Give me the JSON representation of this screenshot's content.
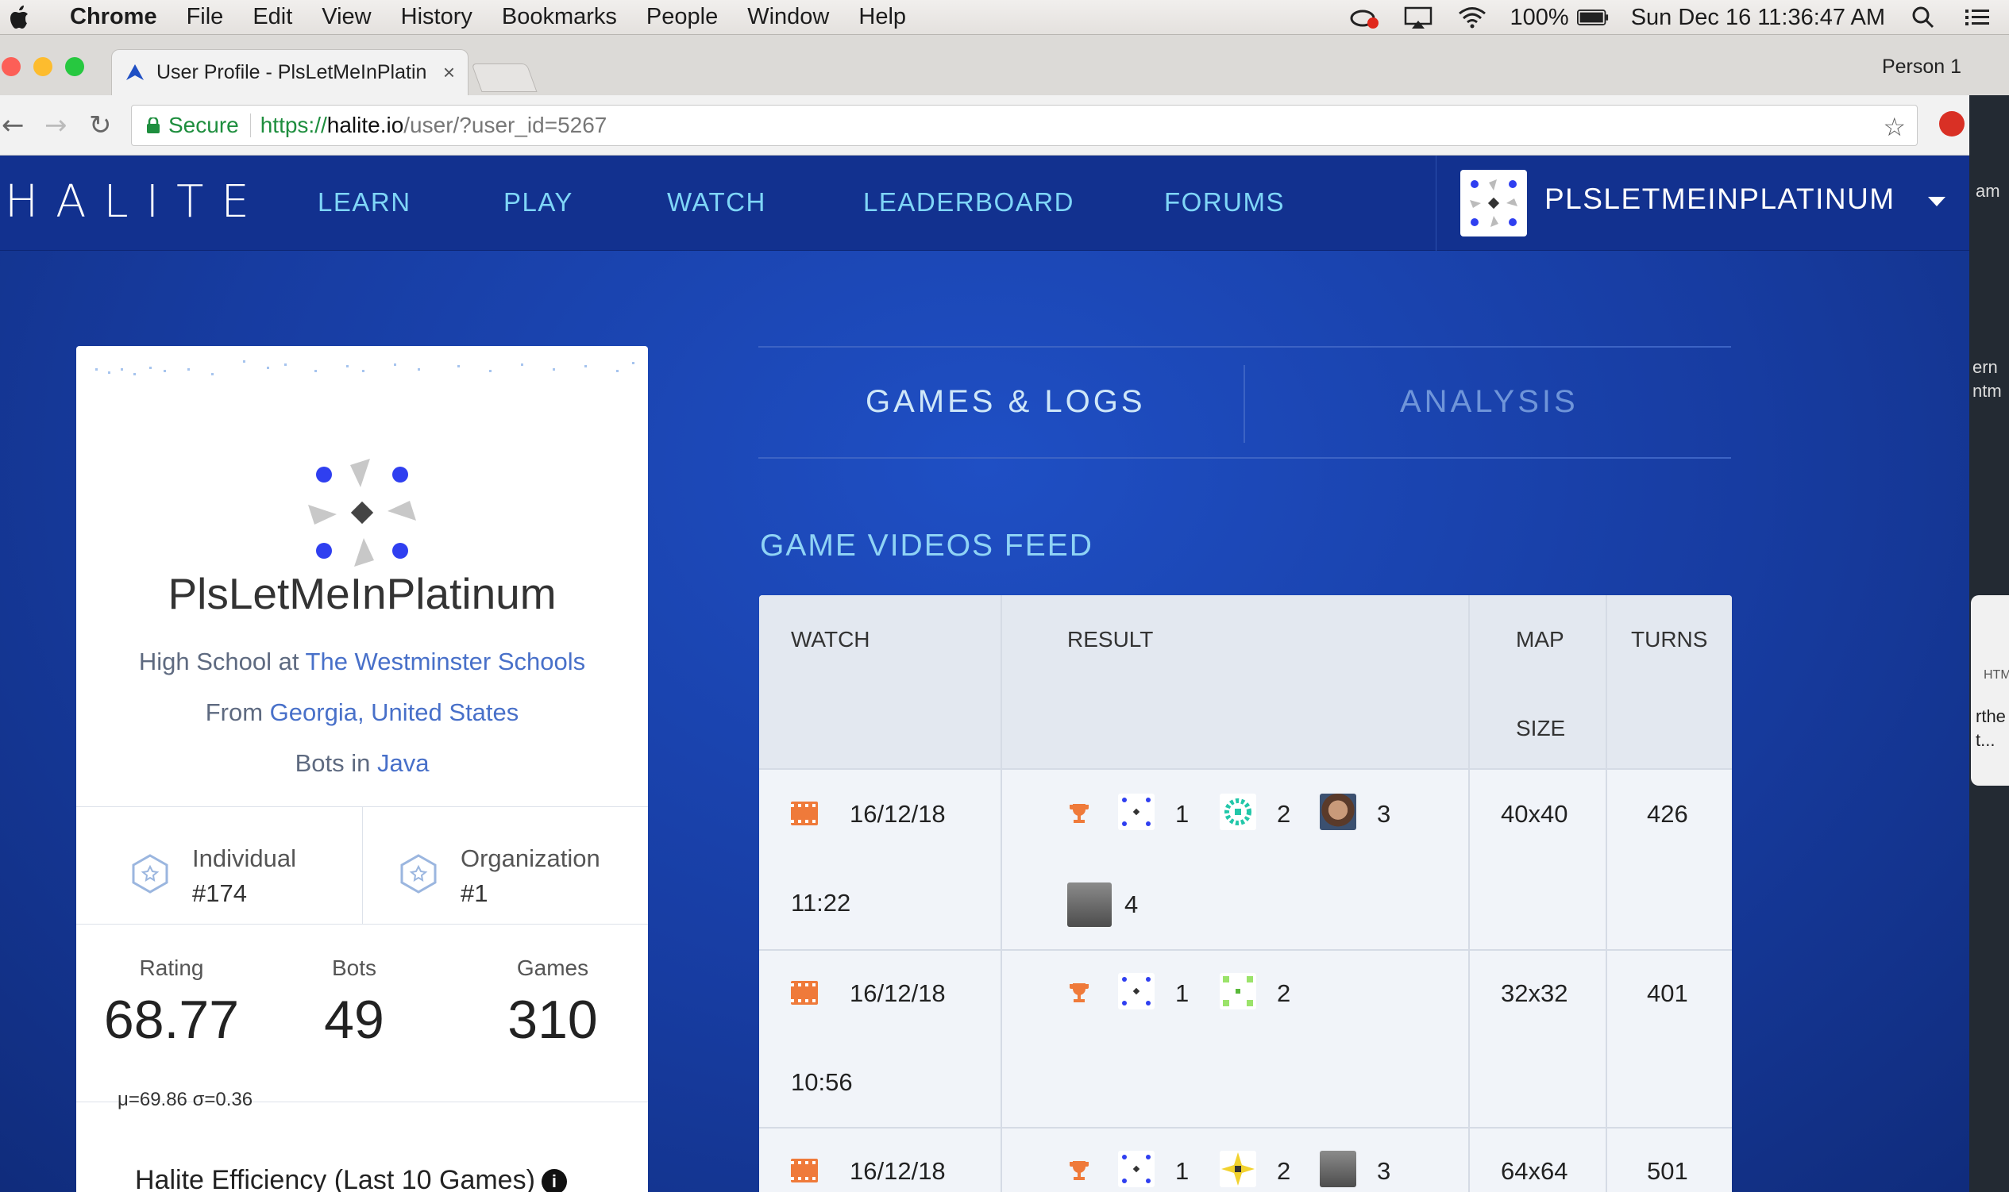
{
  "menubar": {
    "items": [
      "Chrome",
      "File",
      "Edit",
      "View",
      "History",
      "Bookmarks",
      "People",
      "Window",
      "Help"
    ],
    "battery": "100%",
    "clock": "Sun Dec 16  11:36:47 AM"
  },
  "browser": {
    "tab_title": "User Profile - PlsLetMeInPlatin",
    "person": "Person 1",
    "secure_label": "Secure",
    "url_scheme": "https://",
    "url_host": "halite.io",
    "url_path": "/user/?user_id=5267"
  },
  "side_window": {
    "lines": [
      "am",
      "ern",
      "ntm",
      "HTM",
      "rthe",
      "t..."
    ]
  },
  "site": {
    "logo": "HALITE",
    "nav": [
      "LEARN",
      "PLAY",
      "WATCH",
      "LEADERBOARD",
      "FORUMS"
    ],
    "username": "PLSLETMEINPLATINUM"
  },
  "profile": {
    "name": "PlsLetMeInPlatinum",
    "school_prefix": "High School at ",
    "school": "The Westminster Schools",
    "from_prefix": "From ",
    "location": "Georgia, United States",
    "bots_prefix": "Bots in ",
    "language": "Java",
    "individual_label": "Individual",
    "individual_rank": "#174",
    "org_label": "Organization",
    "org_rank": "#1",
    "rating_label": "Rating",
    "rating": "68.77",
    "bots_label": "Bots",
    "bots": "49",
    "games_label": "Games",
    "games": "310",
    "sigma": "μ=69.86 σ=0.36",
    "efficiency": "Halite Efficiency (Last 10 Games)"
  },
  "tabs": {
    "games": "GAMES & LOGS",
    "analysis": "ANALYSIS"
  },
  "feed": {
    "title": "GAME VIDEOS FEED",
    "headers": {
      "watch": "WATCH",
      "result": "RESULT",
      "map": "MAP",
      "map2": "SIZE",
      "turns": "TURNS"
    },
    "rows": [
      {
        "date": "16/12/18",
        "time": "11:22",
        "ranks": [
          "1",
          "2",
          "3",
          "4"
        ],
        "map": "40x40",
        "turns": "426"
      },
      {
        "date": "16/12/18",
        "time": "10:56",
        "ranks": [
          "1",
          "2"
        ],
        "map": "32x32",
        "turns": "401"
      },
      {
        "date": "16/12/18",
        "time": "",
        "ranks": [
          "1",
          "2",
          "3"
        ],
        "map": "64x64",
        "turns": "501"
      }
    ]
  },
  "colors": {
    "brand_blue": "#173ca1",
    "nav_link": "#7fd6f7",
    "accent_orange": "#ef7a3a",
    "bot_blue": "#2f3ff0"
  }
}
